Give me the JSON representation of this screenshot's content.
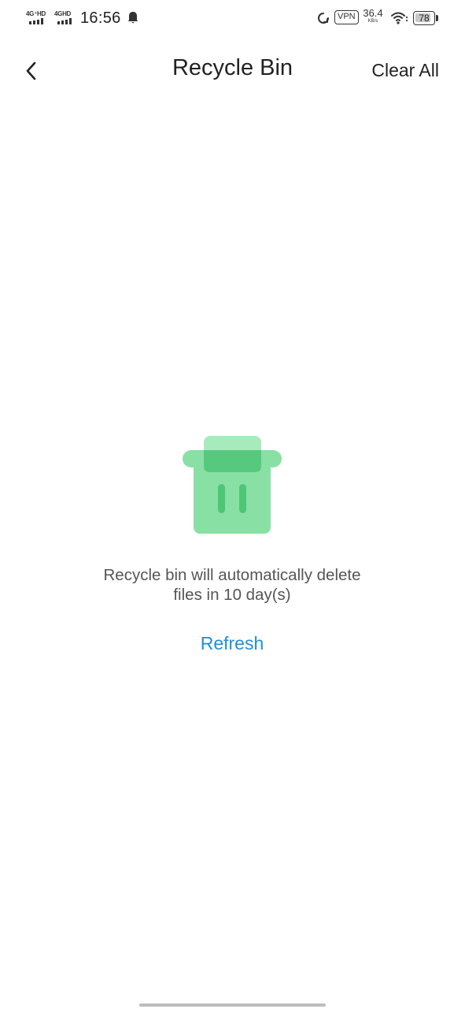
{
  "status_bar": {
    "sim1_label": "4G⁺HD",
    "sim2_label": "4GHD",
    "time": "16:56",
    "vpn_label": "VPN",
    "network_speed": "36.4",
    "network_speed_unit": "KB/s",
    "battery_level": "78",
    "icons": [
      "signal-icon",
      "signal-icon",
      "ghost-icon",
      "sync-icon",
      "wifi-icon",
      "battery-icon"
    ]
  },
  "header": {
    "back_icon": "chevron-left-icon",
    "title": "Recycle Bin",
    "clear_all_label": "Clear All"
  },
  "empty_state": {
    "icon": "trash-bin-icon",
    "message_line1": "Recycle bin will automatically delete",
    "message_line2": "files in 10 day(s)",
    "refresh_label": "Refresh"
  },
  "colors": {
    "accent_link": "#1f8fd8",
    "icon_green_light": "#88e0a5",
    "icon_green_lid": "#a7ebbc",
    "icon_green_dark": "#4fc677"
  }
}
